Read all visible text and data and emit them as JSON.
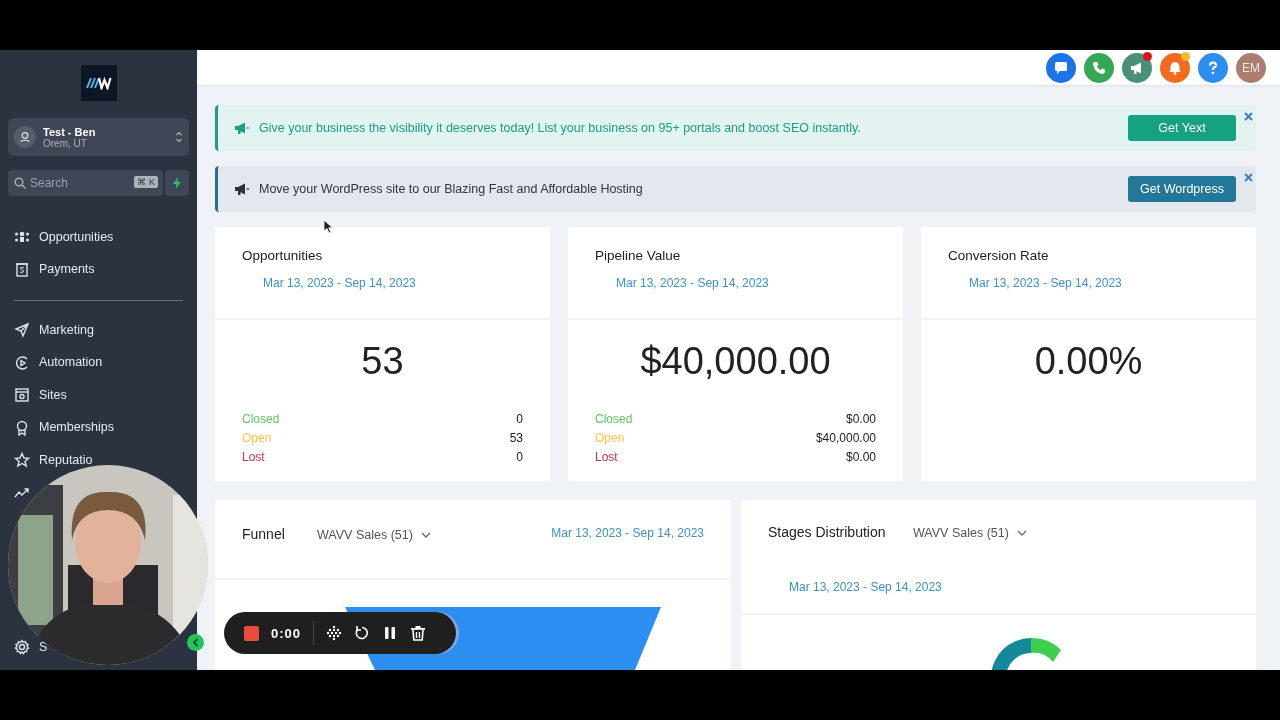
{
  "sidebar": {
    "account": {
      "name": "Test - Ben",
      "location": "Orem, UT"
    },
    "search": {
      "placeholder": "Search",
      "shortcut": "⌘ K"
    },
    "groups": [
      [
        {
          "label": "Opportunities"
        },
        {
          "label": "Payments"
        }
      ],
      [
        {
          "label": "Marketing"
        },
        {
          "label": "Automation"
        },
        {
          "label": "Sites"
        },
        {
          "label": "Memberships"
        },
        {
          "label": "Reputatio"
        }
      ]
    ],
    "footer": {
      "label": "S"
    }
  },
  "header": {
    "buttons": [
      {
        "color": "#1a73e8"
      },
      {
        "color": "#34a853"
      },
      {
        "color": "#4a8f78",
        "badge": {
          "color": "#e0101c"
        }
      },
      {
        "color": "#f26b1d",
        "badge": {
          "color": "#f7b928"
        }
      },
      {
        "color": "#2b8ef0"
      }
    ],
    "avatar": "EM"
  },
  "banners": [
    {
      "kind": "promo",
      "text": "Give your business the visibility it deserves today! List your business on 95+ portals and boost SEO instantly.",
      "button": "Get Yext"
    },
    {
      "kind": "info",
      "text": "Move your WordPress site to our Blazing Fast and Affordable Hosting",
      "button": "Get Wordpress"
    }
  ],
  "stat_cards": [
    {
      "title": "Opportunities",
      "date_range": "Mar 13, 2023 - Sep 14, 2023",
      "value": "53",
      "breakdown": [
        {
          "label": "Closed",
          "value": "0",
          "color": "#5cc85c"
        },
        {
          "label": "Open",
          "value": "53",
          "color": "#f5c542"
        },
        {
          "label": "Lost",
          "value": "0",
          "color": "#d6313f"
        }
      ]
    },
    {
      "title": "Pipeline Value",
      "date_range": "Mar 13, 2023 - Sep 14, 2023",
      "value": "$40,000.00",
      "breakdown": [
        {
          "label": "Closed",
          "value": "$0.00",
          "color": "#5cc85c"
        },
        {
          "label": "Open",
          "value": "$40,000.00",
          "color": "#f5c542"
        },
        {
          "label": "Lost",
          "value": "$0.00",
          "color": "#d6313f"
        }
      ]
    },
    {
      "title": "Conversion Rate",
      "date_range": "Mar 13, 2023 - Sep 14, 2023",
      "value": "0.00%"
    }
  ],
  "panels": [
    {
      "kind": "funnel",
      "title": "Funnel",
      "pipeline": "WAVV Sales (51)",
      "date_range": "Mar 13, 2023 - Sep 14, 2023"
    },
    {
      "kind": "stages",
      "title": "Stages Distribution",
      "pipeline": "WAVV Sales (51)",
      "date_range": "Mar 13, 2023 - Sep 14, 2023"
    }
  ],
  "recorder": {
    "time": "0:00"
  }
}
